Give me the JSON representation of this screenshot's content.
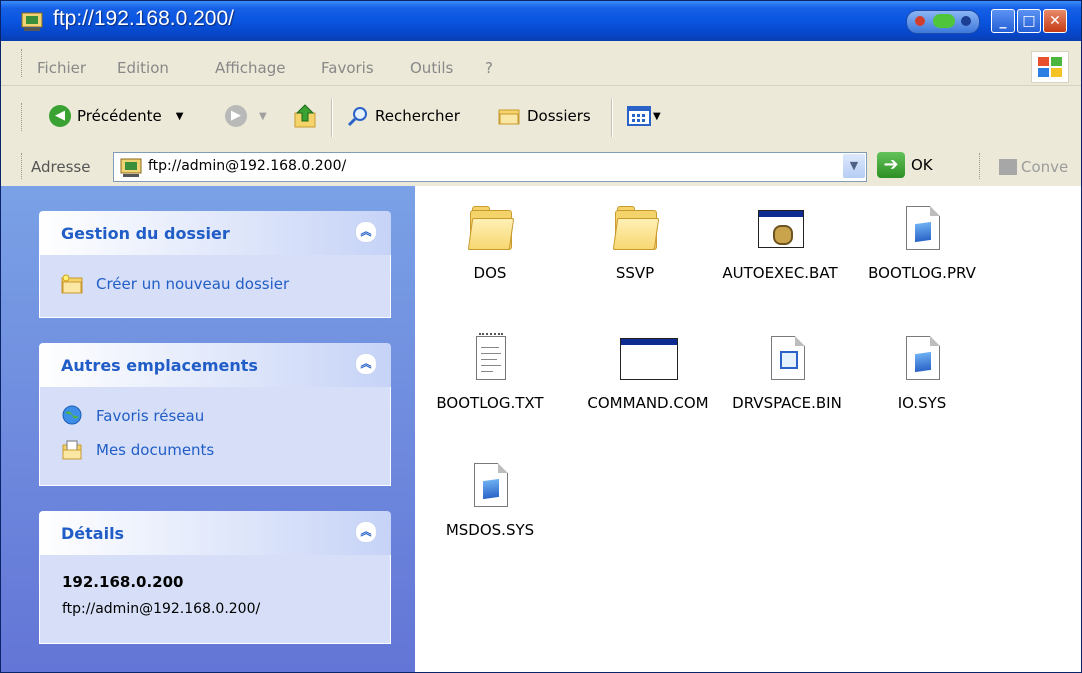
{
  "window": {
    "title": "ftp://192.168.0.200/",
    "controls": [
      "_",
      "□",
      "✕"
    ]
  },
  "menu": {
    "items": [
      "Fichier",
      "Edition",
      "Affichage",
      "Favoris",
      "Outils",
      "?"
    ]
  },
  "toolbar": {
    "back_label": "Précédente",
    "search_label": "Rechercher",
    "folders_label": "Dossiers"
  },
  "address": {
    "label": "Adresse",
    "value": "ftp://admin@192.168.0.200/",
    "go_label": "OK",
    "links_label": "Conve"
  },
  "left_panels": {
    "folder_tasks": {
      "title": "Gestion du dossier",
      "items": [
        "Créer un nouveau dossier"
      ]
    },
    "other_places": {
      "title": "Autres emplacements",
      "items": [
        "Favoris réseau",
        "Mes documents"
      ]
    },
    "details": {
      "title": "Détails",
      "name": "192.168.0.200",
      "path": "ftp://admin@192.168.0.200/"
    }
  },
  "files": [
    {
      "name": "DOS",
      "icon": "folder-icon"
    },
    {
      "name": "SSVP",
      "icon": "folder-icon"
    },
    {
      "name": "AUTOEXEC.BAT",
      "icon": "batch-file-icon"
    },
    {
      "name": "BOOTLOG.PRV",
      "icon": "system-file-icon"
    },
    {
      "name": "BOOTLOG.TXT",
      "icon": "text-file-icon"
    },
    {
      "name": "COMMAND.COM",
      "icon": "program-icon"
    },
    {
      "name": "DRVSPACE.BIN",
      "icon": "binary-file-icon"
    },
    {
      "name": "IO.SYS",
      "icon": "system-file-icon"
    },
    {
      "name": "MSDOS.SYS",
      "icon": "system-file-icon"
    }
  ],
  "colors": {
    "titlebar": "#0a55e0",
    "task_link": "#215dc6",
    "left_pane": "#6375d6"
  }
}
